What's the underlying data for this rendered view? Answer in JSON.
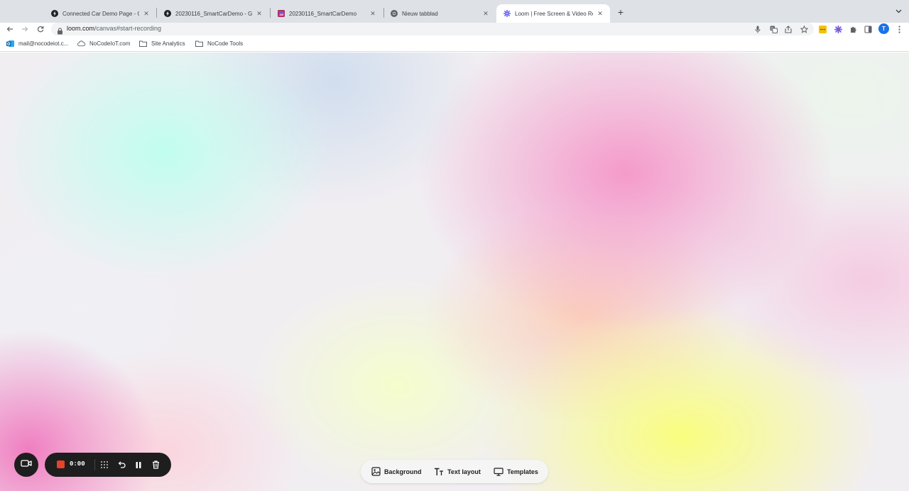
{
  "browser": {
    "tabs": [
      {
        "title": "Connected Car Demo Page - G",
        "icon": "lightning-icon",
        "active": false
      },
      {
        "title": "20230116_SmartCarDemo - Gl",
        "icon": "lightning-icon",
        "active": false
      },
      {
        "title": "20230116_SmartCarDemo",
        "icon": "image-thumbnail-icon",
        "active": false
      },
      {
        "title": "Nieuw tabblad",
        "icon": "chrome-icon",
        "active": false
      },
      {
        "title": "Loom | Free Screen & Video Re",
        "icon": "loom-icon",
        "active": true
      }
    ],
    "url_host": "loom.com",
    "url_path": "/canvas#start-recording",
    "profile_initial": "T",
    "bookmarks": [
      {
        "label": "mail@nocodeiot.c...",
        "icon": "outlook-icon"
      },
      {
        "label": "NoCodeIoT.com",
        "icon": "cloud-icon"
      },
      {
        "label": "Site Analytics",
        "icon": "folder-icon"
      },
      {
        "label": "NoCode Tools",
        "icon": "folder-icon"
      }
    ]
  },
  "recorder": {
    "time": "0:00",
    "stop_color": "#e5432b"
  },
  "canvas_toolbar": {
    "background_label": "Background",
    "text_layout_label": "Text layout",
    "templates_label": "Templates"
  }
}
